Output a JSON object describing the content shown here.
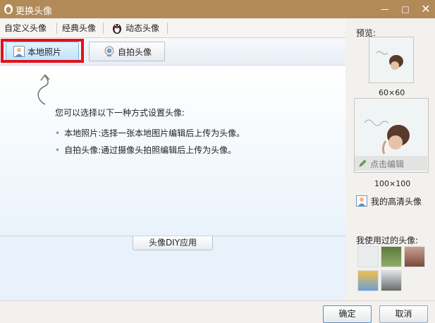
{
  "window": {
    "title": "更换头像",
    "min_glyph": "—",
    "max_glyph": "□",
    "close_glyph": "✕"
  },
  "tabs": [
    {
      "label": "自定义头像"
    },
    {
      "label": "经典头像"
    },
    {
      "label": "动态头像"
    }
  ],
  "toolbar": {
    "local_photo": "本地照片",
    "selfie": "自拍头像"
  },
  "main": {
    "instruction": "您可以选择以下一种方式设置头像:",
    "bullets": [
      "本地照片:选择一张本地图片编辑后上传为头像。",
      "自拍头像:通过摄像头拍照编辑后上传为头像。"
    ],
    "bullet_glyph": "•",
    "diy": "头像DIY应用"
  },
  "side": {
    "preview_label": "预览:",
    "size_small": "60×60",
    "edit_label": "点击编辑",
    "size_large": "100×100",
    "hd_label": "我的高清头像",
    "used_label": "我使用过的头像:"
  },
  "footer": {
    "ok": "确定",
    "cancel": "取消"
  },
  "colors": {
    "titlebar": "#b28a58",
    "highlight": "#e0121b",
    "accent": "#7fb7e0"
  },
  "icons": [
    "qq-penguin-icon",
    "user-photo-icon",
    "webcam-icon",
    "pencil-icon",
    "hd-avatar-icon",
    "curved-arrow-icon"
  ]
}
